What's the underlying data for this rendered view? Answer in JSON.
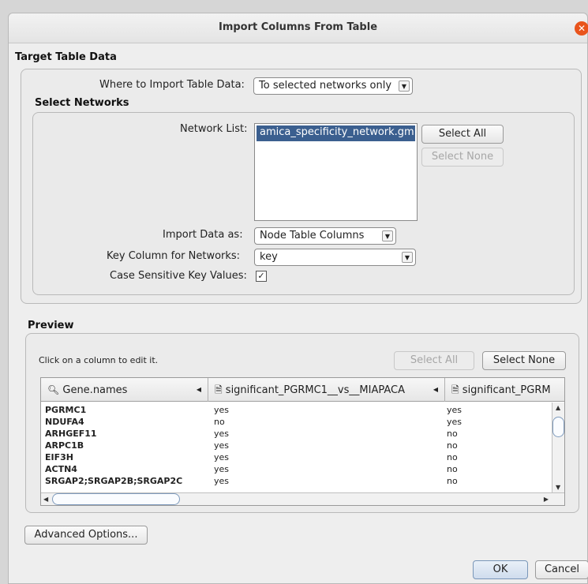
{
  "dialog": {
    "title": "Import Columns From Table"
  },
  "target": {
    "section_title": "Target Table Data",
    "where_label": "Where to Import Table Data:",
    "where_value": "To selected networks only",
    "networks_title": "Select Networks",
    "network_list_label": "Network List:",
    "network_list_items": [
      "amica_specificity_network.gml"
    ],
    "select_all_label": "Select All",
    "select_none_label": "Select None",
    "import_as_label": "Import Data as:",
    "import_as_value": "Node Table Columns",
    "key_column_label": "Key Column for Networks:",
    "key_column_value": "key",
    "case_sensitive_label": "Case Sensitive Key Values:",
    "case_sensitive_checked": true
  },
  "preview": {
    "section_title": "Preview",
    "hint": "Click on a column to edit it.",
    "select_all_label": "Select All",
    "select_none_label": "Select None",
    "columns": [
      "Gene.names",
      "significant_PGRMC1__vs__MIAPACA",
      "significant_PGRM"
    ],
    "rows": [
      [
        "PGRMC1",
        "yes",
        "yes"
      ],
      [
        "NDUFA4",
        "no",
        "yes"
      ],
      [
        "ARHGEF11",
        "yes",
        "no"
      ],
      [
        "ARPC1B",
        "yes",
        "no"
      ],
      [
        "EIF3H",
        "yes",
        "no"
      ],
      [
        "ACTN4",
        "yes",
        "no"
      ],
      [
        "SRGAP2;SRGAP2B;SRGAP2C",
        "yes",
        "no"
      ]
    ]
  },
  "footer": {
    "advanced_label": "Advanced Options...",
    "ok_label": "OK",
    "cancel_label": "Cancel"
  }
}
